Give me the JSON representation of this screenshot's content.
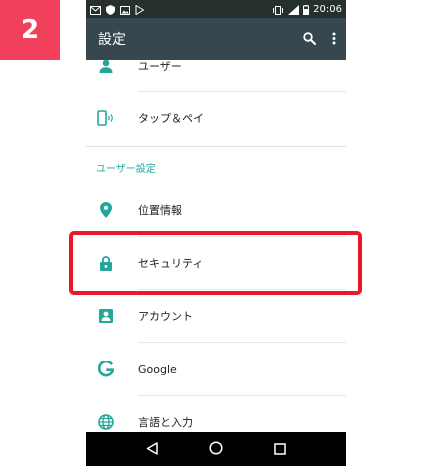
{
  "step_number": "2",
  "status_bar": {
    "time": "20:06",
    "left_icons": [
      "mail-icon",
      "shield-icon",
      "image-icon",
      "play-icon"
    ],
    "right_icons": [
      "vibrate-icon",
      "signal-icon",
      "battery-icon"
    ]
  },
  "toolbar": {
    "title": "設定",
    "actions": [
      "search-icon",
      "more-vert-icon"
    ]
  },
  "settings": {
    "items_top": [
      {
        "label": "ユーザー",
        "icon": "person-icon"
      },
      {
        "label": "タップ＆ペイ",
        "icon": "tap-pay-icon"
      }
    ],
    "section_header": "ユーザー設定",
    "items_user": [
      {
        "label": "位置情報",
        "icon": "location-icon"
      },
      {
        "label": "セキュリティ",
        "icon": "lock-icon"
      },
      {
        "label": "アカウント",
        "icon": "account-box-icon"
      },
      {
        "label": "Google",
        "icon": "google-icon"
      },
      {
        "label": "言語と入力",
        "icon": "globe-icon"
      }
    ]
  },
  "nav_bar": {
    "buttons": [
      "back-icon",
      "home-icon",
      "recents-icon"
    ]
  },
  "colors": {
    "accent": "#26a69a",
    "toolbar": "#37474f",
    "status_bar": "#26312f",
    "highlight": "#e8192c",
    "badge": "#f0405c"
  }
}
